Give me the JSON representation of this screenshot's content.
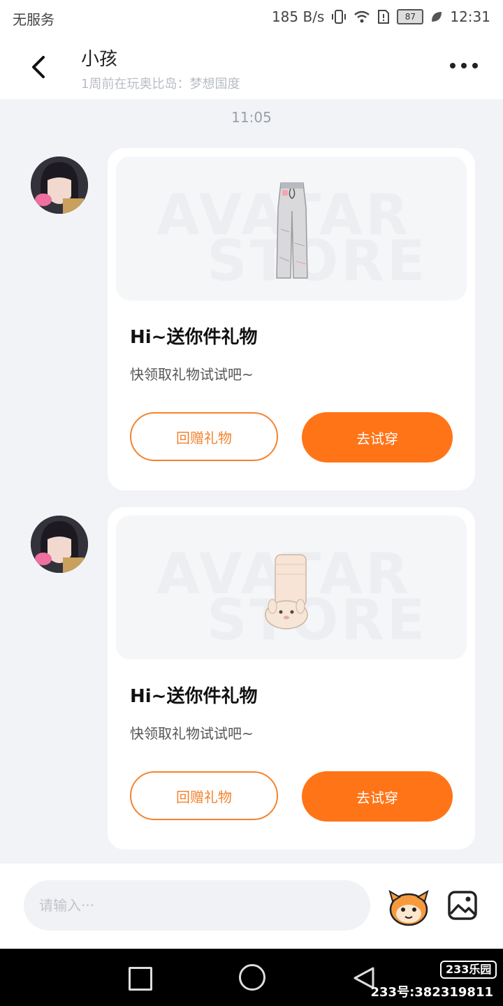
{
  "status_bar": {
    "carrier": "无服务",
    "network_speed": "185 B/s",
    "battery": "87",
    "time": "12:31"
  },
  "header": {
    "title": "小孩",
    "subtitle": "1周前在玩奥比岛：梦想国度"
  },
  "chat": {
    "timestamp": "11:05",
    "messages": [
      {
        "watermark_line1": "AVATAR",
        "watermark_line2": "STORE",
        "item": "pants",
        "title": "Hi~送你件礼物",
        "subtitle": "快领取礼物试试吧~",
        "return_gift_label": "回赠礼物",
        "try_on_label": "去试穿"
      },
      {
        "watermark_line1": "AVATAR",
        "watermark_line2": "STORE",
        "item": "socks",
        "title": "Hi~送你件礼物",
        "subtitle": "快领取礼物试试吧~",
        "return_gift_label": "回赠礼物",
        "try_on_label": "去试穿"
      }
    ]
  },
  "input_bar": {
    "placeholder": "请输入···"
  },
  "watermark": {
    "badge": "233乐园",
    "id_text": "233号:382319811"
  },
  "colors": {
    "accent": "#ff7417",
    "accent_outline": "#f3832e",
    "background": "#f1f3f7"
  }
}
